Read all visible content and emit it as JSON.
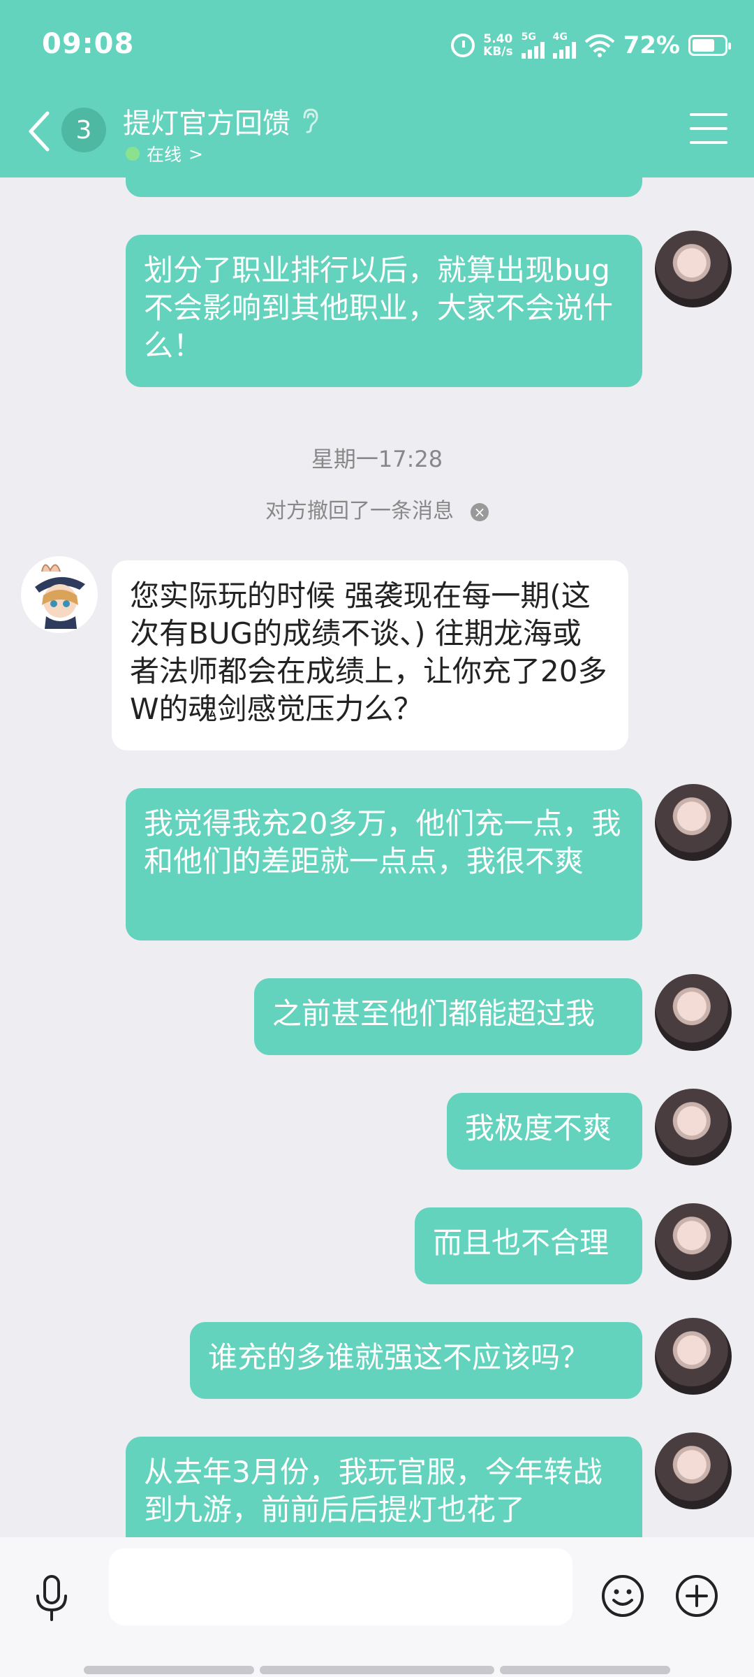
{
  "status_bar": {
    "time": "09:08",
    "speed_value": "5.40",
    "speed_unit": "KB/s",
    "network_1": "5G",
    "network_2": "4G",
    "battery_percent": "72%"
  },
  "header": {
    "unread_count": "3",
    "title": "提灯官方回馈",
    "status": "在线",
    "status_chevron": ">"
  },
  "messages": {
    "m0": "划分了职业排行以后，就算出现bug不会影响到其他职业，大家不会说什么！",
    "timestamp": "星期一17:28",
    "recall_notice": "对方撤回了一条消息",
    "recall_close": "×",
    "m1": "您实际玩的时候 强袭现在每一期(这次有BUG的成绩不谈、) 往期龙海或者法师都会在成绩上，让你充了20多W的魂剑感觉压力么？",
    "m2": "我觉得我充20多万，他们充一点，我和他们的差距就一点点，我很不爽",
    "m3": "之前甚至他们都能超过我",
    "m4": "我极度不爽",
    "m5": "而且也不合理",
    "m6": "谁充的多谁就强这不应该吗？",
    "m7": "从去年3月份，我玩官服，今年转战到九游，前前后后提灯也花了"
  },
  "input": {
    "placeholder": ""
  },
  "icons": {
    "back": "back-arrow-icon",
    "ear": "ear-icon",
    "menu": "menu-icon",
    "mic": "microphone-icon",
    "emoji": "emoji-icon",
    "plus": "plus-icon"
  },
  "colors": {
    "accent": "#63D3BD",
    "background": "#EEEEF2",
    "online_dot": "#8BE28E"
  }
}
